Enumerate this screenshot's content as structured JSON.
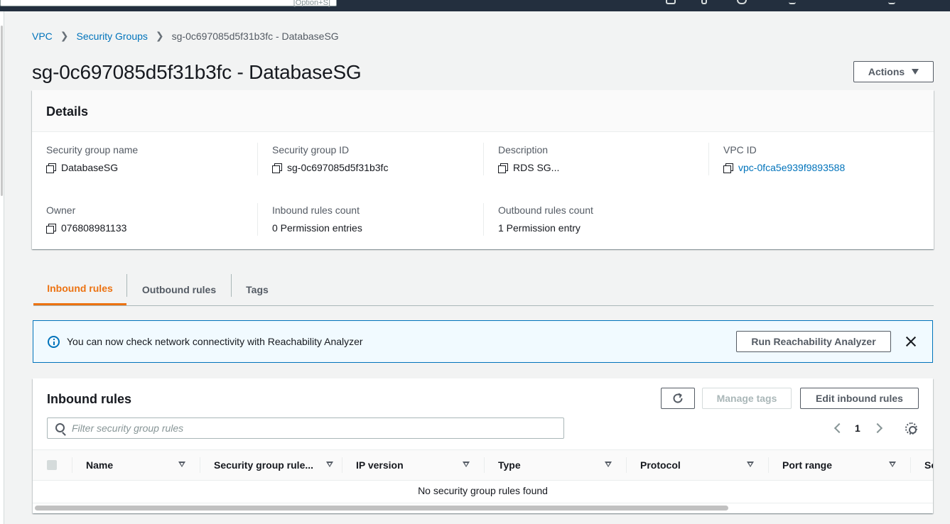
{
  "topbar": {
    "search_shortcut": "[Option+S]"
  },
  "breadcrumb": {
    "vpc": "VPC",
    "security_groups": "Security Groups",
    "current": "sg-0c697085d5f31b3fc - DatabaseSG"
  },
  "page": {
    "title": "sg-0c697085d5f31b3fc - DatabaseSG",
    "actions_label": "Actions"
  },
  "details": {
    "heading": "Details",
    "fields": {
      "sg_name": {
        "label": "Security group name",
        "value": "DatabaseSG"
      },
      "sg_id": {
        "label": "Security group ID",
        "value": "sg-0c697085d5f31b3fc"
      },
      "description": {
        "label": "Description",
        "value": "RDS SG..."
      },
      "vpc_id": {
        "label": "VPC ID",
        "value": "vpc-0fca5e939f9893588"
      },
      "owner": {
        "label": "Owner",
        "value": "076808981133"
      },
      "inbound_count": {
        "label": "Inbound rules count",
        "value": "0 Permission entries"
      },
      "outbound_count": {
        "label": "Outbound rules count",
        "value": "1 Permission entry"
      }
    }
  },
  "tabs": {
    "inbound": "Inbound rules",
    "outbound": "Outbound rules",
    "tags": "Tags"
  },
  "flash": {
    "message": "You can now check network connectivity with Reachability Analyzer",
    "button": "Run Reachability Analyzer"
  },
  "rules": {
    "title": "Inbound rules",
    "manage_tags": "Manage tags",
    "edit_rules": "Edit inbound rules",
    "filter_placeholder": "Filter security group rules",
    "page_number": "1",
    "columns": {
      "name": "Name",
      "rule_id": "Security group rule...",
      "ip_version": "IP version",
      "type": "Type",
      "protocol": "Protocol",
      "port_range": "Port range",
      "source": "So"
    },
    "empty_message": "No security group rules found"
  },
  "colors": {
    "link": "#0073bb",
    "active_tab": "#ec7211",
    "info_bg": "#f1faff",
    "topbar": "#232f3e"
  }
}
